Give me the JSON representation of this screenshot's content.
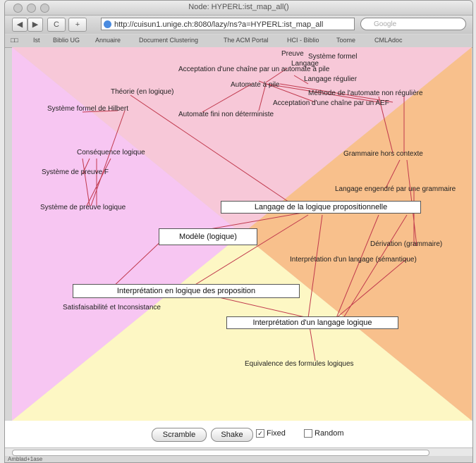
{
  "window": {
    "title": "Node: HYPERL:ist_map_all()"
  },
  "toolbar": {
    "back": "◀",
    "forward": "▶",
    "reload": "C",
    "add": "+",
    "url": "http://cuisun1.unige.ch:8080/lazy/ns?a=HYPERL:ist_map_all",
    "search_placeholder": "Google"
  },
  "bookmarks": [
    "Ist",
    "Biblio UG",
    "Annuaire",
    "Document Clustering",
    "The ACM Portal",
    "HCI - Biblio",
    "Toome",
    "CMLAdoc"
  ],
  "colors": {
    "pink": "#f7c8d8",
    "violet": "#f7c6f2",
    "orange": "#f8c08c",
    "yellow": "#fdf7c4",
    "edge": "#c0394d"
  },
  "nodes": {
    "n1": "Langage de la logique propositionnelle",
    "n2": "Modèle (logique)",
    "n3": "Interprétation en logique des proposition",
    "n4": "Interprétation d'un langage logique"
  },
  "labels": {
    "l01": "Preuve",
    "l02": "Système formel",
    "l03": "Langage",
    "l04": "Acceptation d'une chaîne par un automate à pile",
    "l05": "Langage régulier",
    "l06": "Automate à pile",
    "l07": "Théorie (en logique)",
    "l08": "Méthode de l'automate non régulière",
    "l09": "Système formel de Hilbert",
    "l10": "Acceptation d'une chaîne par un AEF",
    "l11": "Automate fini non déterministe",
    "l12": "Conséquence logique",
    "l13": "Grammaire hors contexte",
    "l14": "Système de preuve F",
    "l15": "Langage engendré par une grammaire",
    "l16": "Système de preuve logique",
    "l17": "Dérivation (grammaire)",
    "l18": "Interprétation d'un langage (sémantique)",
    "l19": "Satisfaisabilité et Inconsistance",
    "l20": "Equivalence des formules logiques"
  },
  "controls": {
    "scramble": "Scramble",
    "shake": "Shake",
    "fixed": "Fixed",
    "random": "Random"
  },
  "status": "Amblad+1ase"
}
